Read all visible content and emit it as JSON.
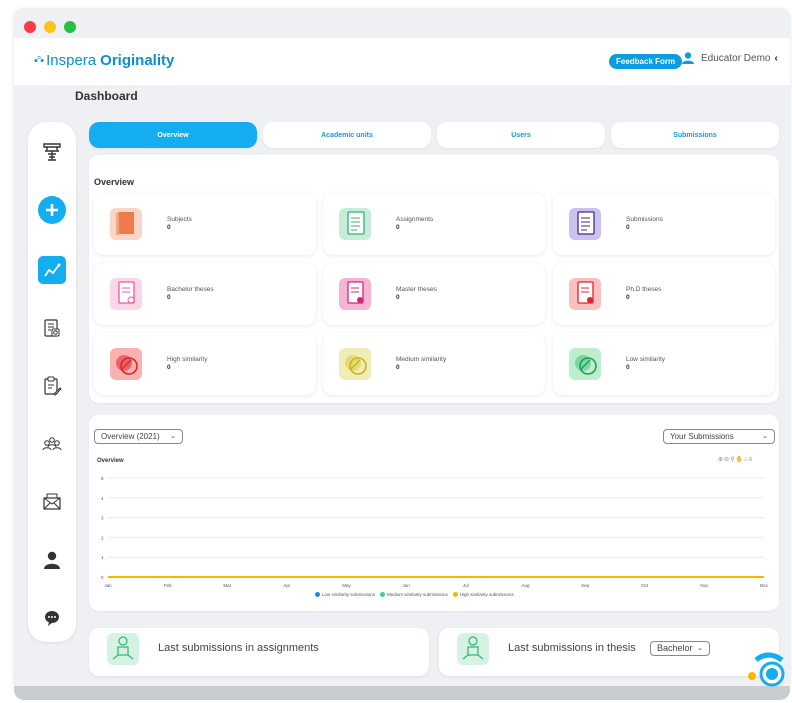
{
  "brand": {
    "prefix": "Inspera",
    "name": "Originality"
  },
  "header": {
    "feedback_label": "Feedback Form",
    "user_name": "Educator Demo"
  },
  "page": {
    "title": "Dashboard"
  },
  "tabs": [
    {
      "label": "Overview",
      "active": true
    },
    {
      "label": "Academic units",
      "active": false
    },
    {
      "label": "Users",
      "active": false
    },
    {
      "label": "Submissions",
      "active": false
    }
  ],
  "overview": {
    "title": "Overview",
    "cards": [
      {
        "label": "Subjects",
        "value": "0",
        "icon": "book-icon",
        "color": "#f4a585"
      },
      {
        "label": "Assignments",
        "value": "0",
        "icon": "document-icon",
        "color": "#9fddbd"
      },
      {
        "label": "Submissions",
        "value": "0",
        "icon": "document-icon",
        "color": "#b6a6e2"
      },
      {
        "label": "Bachelor theses",
        "value": "0",
        "icon": "thesis-icon",
        "color": "#f7b3d4"
      },
      {
        "label": "Master theses",
        "value": "0",
        "icon": "thesis-icon",
        "color": "#f07ab6"
      },
      {
        "label": "Ph.D theses",
        "value": "0",
        "icon": "thesis-icon",
        "color": "#f58a8a"
      },
      {
        "label": "High similarity",
        "value": "0",
        "icon": "similarity-icon",
        "color": "#f59a9a"
      },
      {
        "label": "Medium similarity",
        "value": "0",
        "icon": "similarity-icon",
        "color": "#ece48a"
      },
      {
        "label": "Low similarity",
        "value": "0",
        "icon": "similarity-icon",
        "color": "#9ee3b3"
      }
    ]
  },
  "chart_controls": {
    "period": "Overview (2021)",
    "scope": "Your Submissions"
  },
  "chart_data": {
    "type": "line",
    "title": "Overview",
    "categories": [
      "Jan",
      "Feb",
      "Mar",
      "Apr",
      "May",
      "Jun",
      "Jul",
      "Aug",
      "Sep",
      "Oct",
      "Nov",
      "Dec"
    ],
    "yticks": [
      "5",
      "4",
      "3",
      "2",
      "1",
      "0"
    ],
    "ylim": [
      0,
      5
    ],
    "series": [
      {
        "name": "Low similarity submissions",
        "color": "#1e88e5",
        "values": [
          0,
          0,
          0,
          0,
          0,
          0,
          0,
          0,
          0,
          0,
          0,
          0
        ]
      },
      {
        "name": "Medium similarity submissions",
        "color": "#3ccf8e",
        "values": [
          0,
          0,
          0,
          0,
          0,
          0,
          0,
          0,
          0,
          0,
          0,
          0
        ]
      },
      {
        "name": "High similarity submissions",
        "color": "#f5b800",
        "values": [
          0,
          0,
          0,
          0,
          0,
          0,
          0,
          0,
          0,
          0,
          0,
          0
        ]
      }
    ],
    "legend": "bottom-center"
  },
  "bottom": {
    "assignments_label": "Last submissions in assignments",
    "thesis_label": "Last submissions in thesis",
    "thesis_filter": "Bachelor"
  },
  "colors": {
    "accent": "#14aef0",
    "brand": "#0b8fd0"
  }
}
